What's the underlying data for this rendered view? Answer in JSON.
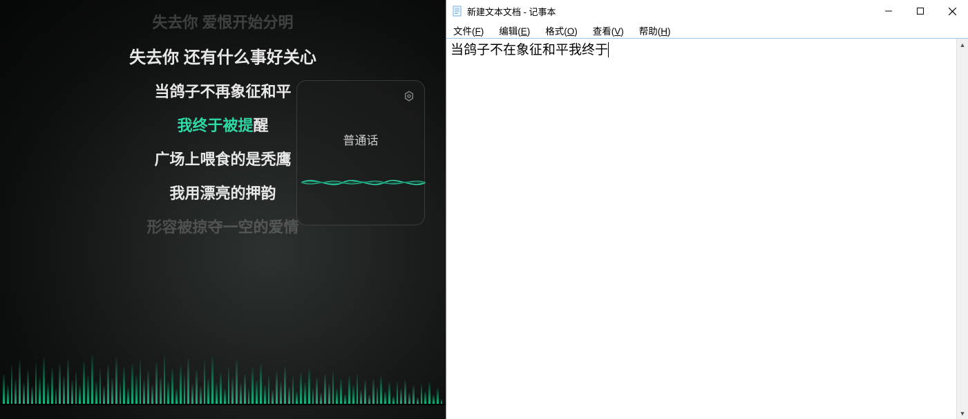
{
  "left": {
    "lyrics": {
      "faded_top": "失去你 爱恨开始分明",
      "line1": "失去你 还有什么事好关心",
      "line2": "当鸽子不再象征和平",
      "active_part1": "我终于被提",
      "active_part2": "醒",
      "line4": "广场上喂食的是秃鹰",
      "line5": "我用漂亮的押韵",
      "faded_bottom": "形容被掠夺一空的爱情"
    },
    "voice_card": {
      "label": "普通话",
      "settings_icon": "settings-icon"
    },
    "colors": {
      "highlight": "#2fd9a6",
      "wave": "#2fd9a6"
    }
  },
  "notepad": {
    "title": "新建文本文档 - 记事本",
    "menus": {
      "file": "文件(F)",
      "edit": "编辑(E)",
      "format": "格式(O)",
      "view": "查看(V)",
      "help": "帮助(H)"
    },
    "content": "当鸽子不在象征和平我终于"
  }
}
